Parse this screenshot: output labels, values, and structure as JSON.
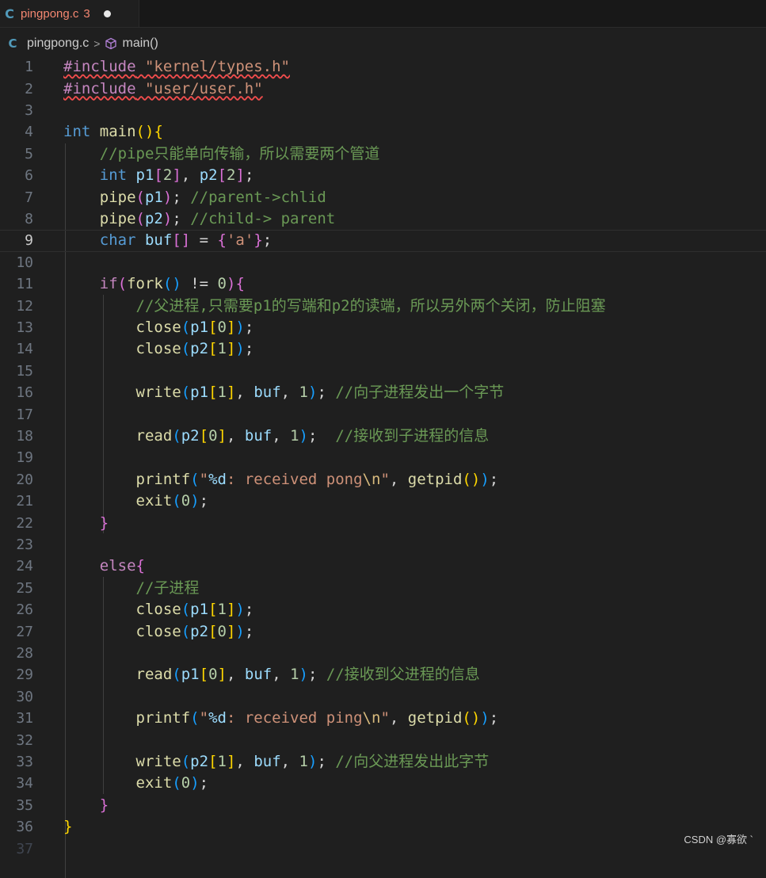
{
  "tab": {
    "file_icon": "C",
    "filename": "pingpong.c",
    "problem_count": "3"
  },
  "breadcrumb": {
    "file_icon": "C",
    "file": "pingpong.c",
    "separator": ">",
    "symbol": "main()"
  },
  "editor": {
    "current_line": 9,
    "line_numbers": [
      "1",
      "2",
      "3",
      "4",
      "5",
      "6",
      "7",
      "8",
      "9",
      "10",
      "11",
      "12",
      "13",
      "14",
      "15",
      "16",
      "17",
      "18",
      "19",
      "20",
      "21",
      "22",
      "23",
      "24",
      "25",
      "26",
      "27",
      "28",
      "29",
      "30",
      "31",
      "32",
      "33",
      "34",
      "35",
      "36",
      "37"
    ],
    "lines": [
      "#include \"kernel/types.h\"",
      "#include \"user/user.h\"",
      "",
      "int main(){",
      "    //pipe只能单向传输，所以需要两个管道",
      "    int p1[2], p2[2];",
      "    pipe(p1); //parent->chlid",
      "    pipe(p2); //child-> parent",
      "    char buf[] = {'a'};",
      "",
      "    if(fork() != 0){",
      "        //父进程,只需要p1的写端和p2的读端，所以另外两个关闭，防止阻塞",
      "        close(p1[0]);",
      "        close(p2[1]);",
      "",
      "        write(p1[1], buf, 1); //向子进程发出一个字节",
      "",
      "        read(p2[0], buf, 1);  //接收到子进程的信息",
      "",
      "        printf(\"%d: received pong\\n\", getpid());",
      "        exit(0);",
      "    }",
      "",
      "    else{",
      "        //子进程",
      "        close(p1[1]);",
      "        close(p2[0]);",
      "",
      "        read(p1[0], buf, 1); //接收到父进程的信息",
      "",
      "        printf(\"%d: received ping\\n\", getpid());",
      "",
      "        write(p2[1], buf, 1); //向父进程发出此字节",
      "        exit(0);",
      "    }",
      "}",
      ""
    ]
  },
  "watermark": "CSDN @寡欲 `",
  "colors": {
    "keyword": "#569cd6",
    "control": "#c586c0",
    "function": "#dcdcaa",
    "variable": "#9cdcfe",
    "number": "#b5cea8",
    "string": "#ce9178",
    "comment": "#6a9955",
    "bracket_1": "#ffd700",
    "bracket_2": "#da70d6",
    "bracket_3": "#179fff"
  }
}
